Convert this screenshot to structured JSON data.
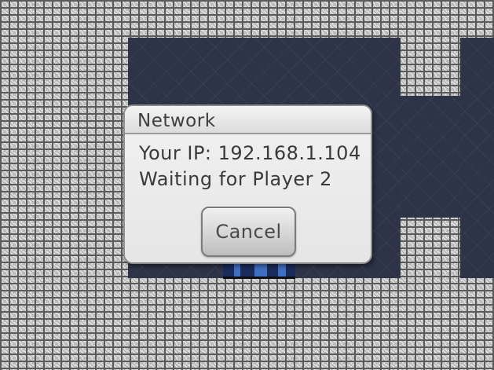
{
  "dialog": {
    "title": "Network",
    "ip_line": "Your IP: 192.168.1.104",
    "status_line": "Waiting for Player 2",
    "cancel_label": "Cancel"
  }
}
